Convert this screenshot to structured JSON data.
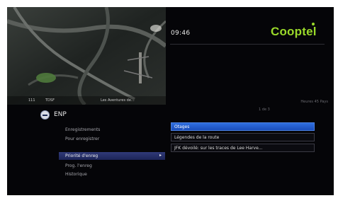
{
  "clock": "09:46",
  "brand": "Cooptel",
  "video": {
    "caption": [
      "111",
      "TDSF",
      "Les Aventures de..."
    ]
  },
  "info": {
    "right_text": "Heures 45 Pays",
    "page": "1 de 3"
  },
  "menu": {
    "title": "ENP",
    "items": [
      {
        "label": "Enregistrements"
      },
      {
        "label": "Pour enregistrer"
      },
      {
        "label": "Priorité d'enreg"
      },
      {
        "label": "Prog. l'enreg"
      },
      {
        "label": "Historique"
      }
    ],
    "selected_index": 2
  },
  "recordings": [
    {
      "label": "Otages"
    },
    {
      "label": "Légendes de la route"
    },
    {
      "label": "JFK dévoilé: sur les traces de Lee Harve..."
    }
  ],
  "colors": {
    "brand": "#9ad92a",
    "highlight": "#2f6fe0",
    "menu_highlight": "#303a78"
  }
}
